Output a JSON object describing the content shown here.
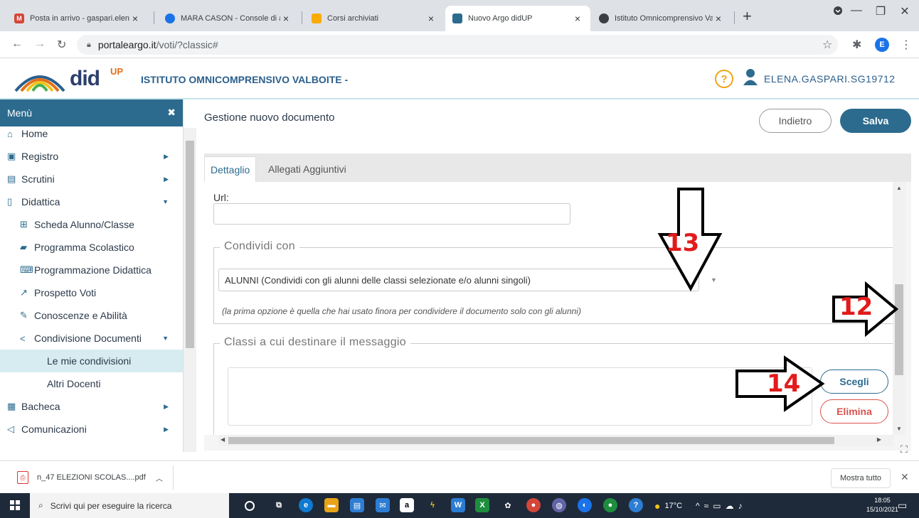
{
  "browser": {
    "tabs": [
      {
        "label": "Posta in arrivo - gaspari.elena@",
        "favicon_color": "#d44638",
        "active": false
      },
      {
        "label": "MARA CASON - Console di am",
        "favicon_color": "#1a73e8",
        "active": false
      },
      {
        "label": "Corsi archiviati",
        "favicon_color": "#1e8e3e",
        "active": false
      },
      {
        "label": "Nuovo Argo didUP",
        "favicon_color": "#2c6b8e",
        "active": true
      },
      {
        "label": "Istituto Omnicomprensivo Val",
        "favicon_color": "#3c4043",
        "active": false
      }
    ],
    "url_host": "portaleargo.it",
    "url_path": "/voti/?classic#",
    "profile_initial": "E"
  },
  "app": {
    "logo_text": "did",
    "logo_sup": "UP",
    "school_name": "ISTITUTO OMNICOMPRENSIVO VALBOITE -",
    "help_label": "?",
    "username": "ELENA.GASPARI.SG19712"
  },
  "sidebar": {
    "header": "Menù",
    "items": [
      {
        "label": "Home",
        "icon": "home-icon"
      },
      {
        "label": "Registro",
        "icon": "calendar-icon"
      },
      {
        "label": "Scrutini",
        "icon": "report-icon"
      },
      {
        "label": "Didattica",
        "icon": "book-icon"
      },
      {
        "label": "Scheda Alunno/Classe",
        "icon": "table-icon"
      },
      {
        "label": "Programma Scolastico",
        "icon": "book-solid-icon"
      },
      {
        "label": "Programmazione Didattica",
        "icon": "keyboard-icon"
      },
      {
        "label": "Prospetto Voti",
        "icon": "chart-icon"
      },
      {
        "label": "Conoscenze e Abilità",
        "icon": "magic-icon"
      },
      {
        "label": "Condivisione Documenti",
        "icon": "share-icon"
      },
      {
        "label": "Le mie condivisioni",
        "icon": ""
      },
      {
        "label": "Altri Docenti",
        "icon": ""
      },
      {
        "label": "Bacheca",
        "icon": "board-icon"
      },
      {
        "label": "Comunicazioni",
        "icon": "megaphone-icon"
      }
    ]
  },
  "page": {
    "title": "Gestione nuovo documento",
    "back_label": "Indietro",
    "save_label": "Salva",
    "tabs": [
      "Dettaglio",
      "Allegati Aggiuntivi"
    ],
    "url_label": "Url:",
    "url_value": "",
    "share_legend": "Condividi con",
    "share_selected": "ALUNNI (Condividi con gli alunni delle classi selezionate e/o alunni singoli)",
    "share_hint": "(la prima opzione è quella che hai usato finora per condividere il documento solo con gli alunni)",
    "classes_legend": "Classi a cui destinare il messaggio",
    "choose_label": "Scegli",
    "delete_label": "Elimina"
  },
  "annotations": [
    "13",
    "12",
    "14"
  ],
  "downloads": {
    "file": "n_47 ELEZIONI SCOLAS....pdf",
    "show_all": "Mostra tutto"
  },
  "taskbar": {
    "search_placeholder": "Scrivi qui per eseguire la ricerca",
    "weather": "17°C",
    "time": "18:05",
    "date": "15/10/2021"
  },
  "colors": {
    "primary": "#2c6b8e",
    "danger": "#d9534f",
    "annotation": "#e21b1b"
  }
}
